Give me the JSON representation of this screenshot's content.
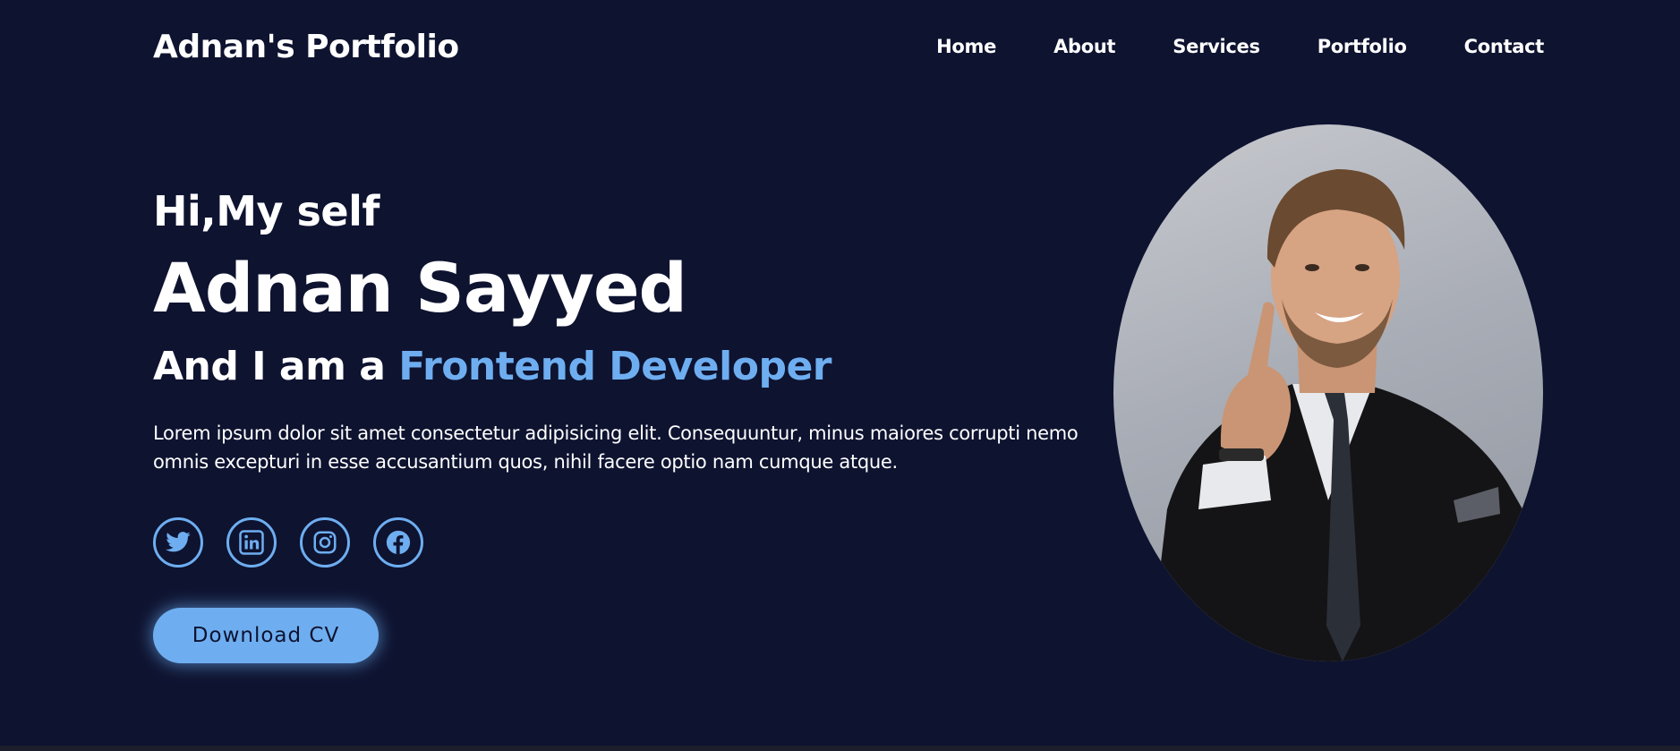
{
  "header": {
    "logo": "Adnan's Portfolio",
    "nav": [
      "Home",
      "About",
      "Services",
      "Portfolio",
      "Contact"
    ]
  },
  "hero": {
    "greeting": "Hi,My self",
    "name": "Adnan Sayyed",
    "role_prefix": "And I am a ",
    "role_highlight": "Frontend Developer",
    "description": "Lorem ipsum dolor sit amet consectetur adipisicing elit. Consequuntur, minus maiores corrupti nemo omnis excepturi in esse accusantium quos, nihil facere optio nam cumque atque.",
    "socials": [
      "twitter-icon",
      "linkedin-icon",
      "instagram-icon",
      "facebook-icon"
    ],
    "cv_button": "Download CV"
  },
  "colors": {
    "background": "#0e1330",
    "accent": "#6eaef0",
    "text": "#ffffff"
  }
}
